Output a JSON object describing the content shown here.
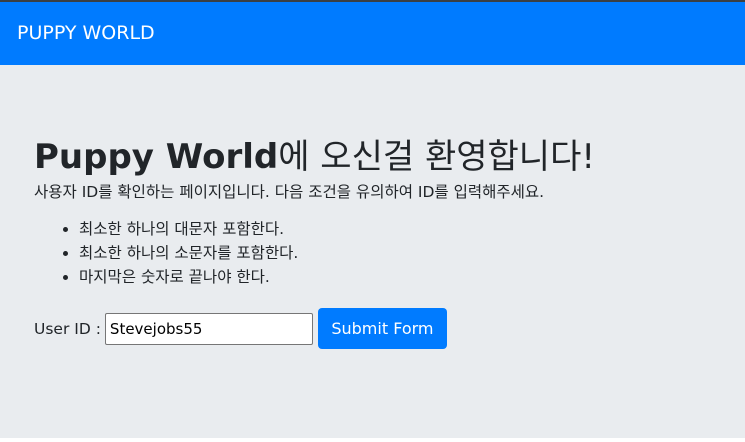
{
  "navbar": {
    "brand": "PUPPY WORLD"
  },
  "jumbotron": {
    "title_bold": "Puppy World",
    "title_rest": "에 오신걸 환영합니다!",
    "intro": "사용자 ID를 확인하는 페이지입니다. 다음 조건을 유의하여 ID를 입력해주세요.",
    "rules": [
      "최소한 하나의 대문자 포함한다.",
      "최소한 하나의 소문자를 포함한다.",
      "마지막은 숫자로 끝나야 한다."
    ]
  },
  "form": {
    "label": "User ID :",
    "user_id_value": "Stevejobs55",
    "submit_label": "Submit Form"
  },
  "colors": {
    "primary": "#007bff",
    "jumbotron_bg": "#e9ecef",
    "text": "#212529"
  }
}
